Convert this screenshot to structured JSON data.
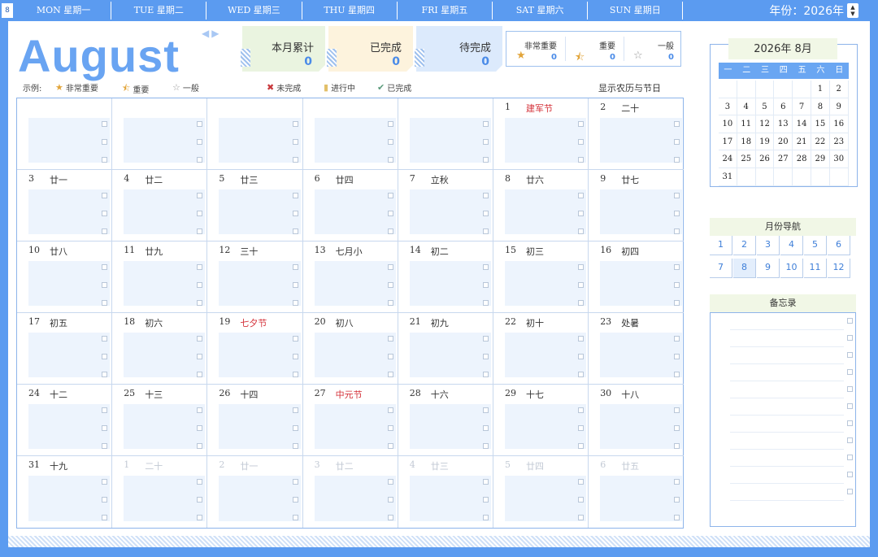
{
  "header": {
    "corner": "8",
    "weekdays": [
      "MON 星期一",
      "TUE 星期二",
      "WED 星期三",
      "THU 星期四",
      "FRI 星期五",
      "SAT 星期六",
      "SUN 星期日"
    ],
    "year_label": "年份：2026年",
    "spin_up": "▲",
    "spin_down": "▼"
  },
  "month": {
    "title": "August",
    "prev": "◀",
    "next": "▶"
  },
  "stats": [
    {
      "label": "本月累计",
      "value": "0",
      "bg": "#eaf4e0"
    },
    {
      "label": "已完成",
      "value": "0",
      "bg": "#fdf3dd"
    },
    {
      "label": "待完成",
      "value": "0",
      "bg": "#dceafc"
    }
  ],
  "priority": [
    {
      "label": "非常重要",
      "star": "★",
      "color": "#e2a53b",
      "count": "0"
    },
    {
      "label": "重要",
      "star": "⯪",
      "color": "#e2a53b",
      "count": "0"
    },
    {
      "label": "一般",
      "star": "☆",
      "color": "#999999",
      "count": "0"
    }
  ],
  "legend": {
    "prefix": "示例:",
    "items": [
      {
        "icon": "★",
        "color": "#e2a53b",
        "label": "非常重要"
      },
      {
        "icon": "⯪",
        "color": "#e2a53b",
        "label": "重要"
      },
      {
        "icon": "☆",
        "color": "#999999",
        "label": "一般"
      },
      {
        "icon": "✖",
        "color": "#c8383c",
        "label": "未完成"
      },
      {
        "icon": "▮",
        "color": "#e2c06a",
        "label": "进行中"
      },
      {
        "icon": "✔",
        "color": "#5a9a7a",
        "label": "已完成"
      }
    ],
    "lunar_toggle": "显示农历与节日"
  },
  "calendar": {
    "weeks": [
      [
        {
          "d": "",
          "l": ""
        },
        {
          "d": "",
          "l": ""
        },
        {
          "d": "",
          "l": ""
        },
        {
          "d": "",
          "l": ""
        },
        {
          "d": "",
          "l": ""
        },
        {
          "d": "1",
          "l": "建军节",
          "fest": true
        },
        {
          "d": "2",
          "l": "二十"
        }
      ],
      [
        {
          "d": "3",
          "l": "廿一"
        },
        {
          "d": "4",
          "l": "廿二"
        },
        {
          "d": "5",
          "l": "廿三"
        },
        {
          "d": "6",
          "l": "廿四"
        },
        {
          "d": "7",
          "l": "立秋"
        },
        {
          "d": "8",
          "l": "廿六"
        },
        {
          "d": "9",
          "l": "廿七"
        }
      ],
      [
        {
          "d": "10",
          "l": "廿八"
        },
        {
          "d": "11",
          "l": "廿九"
        },
        {
          "d": "12",
          "l": "三十"
        },
        {
          "d": "13",
          "l": "七月小"
        },
        {
          "d": "14",
          "l": "初二"
        },
        {
          "d": "15",
          "l": "初三"
        },
        {
          "d": "16",
          "l": "初四"
        }
      ],
      [
        {
          "d": "17",
          "l": "初五"
        },
        {
          "d": "18",
          "l": "初六"
        },
        {
          "d": "19",
          "l": "七夕节",
          "fest": true
        },
        {
          "d": "20",
          "l": "初八"
        },
        {
          "d": "21",
          "l": "初九"
        },
        {
          "d": "22",
          "l": "初十"
        },
        {
          "d": "23",
          "l": "处暑"
        }
      ],
      [
        {
          "d": "24",
          "l": "十二"
        },
        {
          "d": "25",
          "l": "十三"
        },
        {
          "d": "26",
          "l": "十四"
        },
        {
          "d": "27",
          "l": "中元节",
          "fest": true
        },
        {
          "d": "28",
          "l": "十六"
        },
        {
          "d": "29",
          "l": "十七"
        },
        {
          "d": "30",
          "l": "十八"
        }
      ],
      [
        {
          "d": "31",
          "l": "十九"
        },
        {
          "d": "1",
          "l": "二十",
          "dim": true
        },
        {
          "d": "2",
          "l": "廿一",
          "dim": true
        },
        {
          "d": "3",
          "l": "廿二",
          "dim": true
        },
        {
          "d": "4",
          "l": "廿三",
          "dim": true
        },
        {
          "d": "5",
          "l": "廿四",
          "dim": true
        },
        {
          "d": "6",
          "l": "廿五",
          "dim": true
        }
      ]
    ]
  },
  "mini_calendar": {
    "title": "2026年  8月",
    "weekdays": [
      "一",
      "二",
      "三",
      "四",
      "五",
      "六",
      "日"
    ],
    "weeks": [
      [
        "",
        "",
        "",
        "",
        "",
        "1",
        "2"
      ],
      [
        "3",
        "4",
        "5",
        "6",
        "7",
        "8",
        "9"
      ],
      [
        "10",
        "11",
        "12",
        "13",
        "14",
        "15",
        "16"
      ],
      [
        "17",
        "18",
        "19",
        "20",
        "21",
        "22",
        "23"
      ],
      [
        "24",
        "25",
        "26",
        "27",
        "28",
        "29",
        "30"
      ],
      [
        "31",
        "",
        "",
        "",
        "",
        "",
        ""
      ]
    ]
  },
  "month_nav": {
    "title": "月份导航",
    "months": [
      "1",
      "2",
      "3",
      "4",
      "5",
      "6",
      "7",
      "8",
      "9",
      "10",
      "11",
      "12"
    ],
    "active": "8"
  },
  "memo": {
    "title": "备忘录",
    "lines": 11
  },
  "colors": {
    "accent": "#5b9bf0",
    "festival": "#d4323a",
    "value": "#4a8be8"
  }
}
